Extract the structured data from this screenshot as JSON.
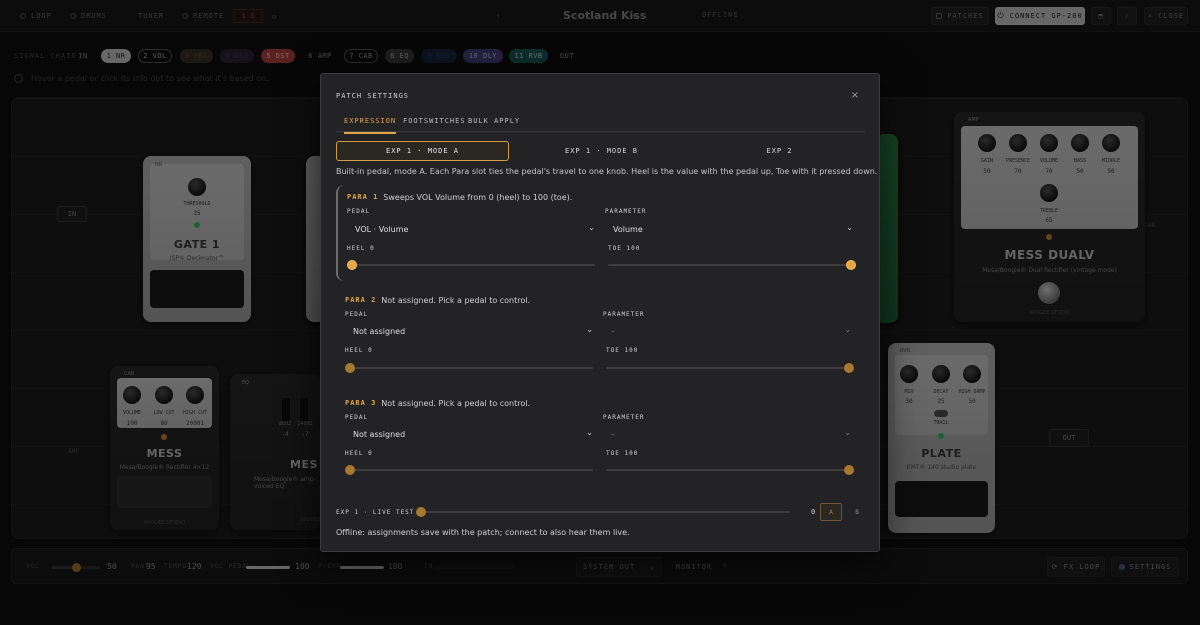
{
  "topbar": {
    "loop": "LOOP",
    "drums": "DRUMS",
    "tuner": "TUNER",
    "remote": "REMOTE",
    "midi": "1 3",
    "patch_title": "Scotland Kiss",
    "status": "OFFLINE",
    "patches": "PATCHES",
    "connect": "CONNECT GP-200",
    "close": "CLOSE"
  },
  "chain": {
    "label": "SIGNAL CHAIN",
    "chips": [
      {
        "label": "IN"
      },
      {
        "label": "1 NR"
      },
      {
        "label": "2 VOL"
      },
      {
        "label": "3 PRE"
      },
      {
        "label": "4 DST"
      },
      {
        "label": "5 DST"
      },
      {
        "label": "6 AMP"
      },
      {
        "label": "7 CAB"
      },
      {
        "label": "8 EQ"
      },
      {
        "label": "9 MOD"
      },
      {
        "label": "10 DLY"
      },
      {
        "label": "11 RVB"
      },
      {
        "label": "OUT"
      }
    ],
    "hint": "Hover a pedal or click its info dot to see what it's based on."
  },
  "board": {
    "in_label": "IN",
    "out_label": "OUT",
    "amp_label": "AMP",
    "cab_label": "CAB",
    "gate": {
      "tag": "NR",
      "slot": "1",
      "knob_label": "THRESHOLD",
      "knob_value": "35",
      "name": "GATE 1",
      "sub": "ISP® Decimator™",
      "brand": "APOGEE STUDIO"
    },
    "cab": {
      "tag": "CAB",
      "slot": "7",
      "knobs": [
        {
          "label": "VOLUME",
          "value": "100"
        },
        {
          "label": "LOW CUT",
          "value": "80"
        },
        {
          "label": "HIGH CUT",
          "value": "20001"
        }
      ],
      "name": "MESS",
      "sub": "Mesa/Boogie® Rectifier 4×12",
      "brand": "APOGEE STUDIO"
    },
    "eq": {
      "tag": "EQ",
      "bands": [
        {
          "label": "80HZ",
          "value": "-4"
        },
        {
          "label": "240HZ",
          "value": "-7"
        }
      ],
      "name": "MES",
      "sub": "Mesa/Boogie® amp-voiced EQ",
      "brand": "APOGEE"
    },
    "amp": {
      "tag": "AMP",
      "knobs": [
        {
          "label": "GAIN",
          "value": "50"
        },
        {
          "label": "PRESENCE",
          "value": "70"
        },
        {
          "label": "VOLUME",
          "value": "70"
        },
        {
          "label": "BASS",
          "value": "50"
        },
        {
          "label": "MIDDLE",
          "value": "50"
        }
      ],
      "treble_label": "TREBLE",
      "treble_value": "65",
      "name": "MESS DUALV",
      "sub": "Mesa/Boogie® Dual Rectifier (vintage mode)",
      "brand": "APOGEE STUDIO"
    },
    "reverb": {
      "tag": "RVB",
      "knobs": [
        {
          "label": "MIX",
          "value": "30"
        },
        {
          "label": "DECAY",
          "value": "25"
        },
        {
          "label": "HIGH DAMP",
          "value": "50"
        }
      ],
      "trail_label": "TRAIL",
      "name": "PLATE",
      "sub": "EMT® 140 studio plate"
    }
  },
  "bottombar": {
    "vol_label": "VOL",
    "vol_value": "50",
    "vol_level": 0.5,
    "pan_label": "PAN",
    "pan_value": "95",
    "tempo_label": "TEMPO",
    "tempo_value": "120",
    "vol_pedal_label": "VOL PEDAL",
    "vol_pedal_value": "100",
    "vol_pedal_level": 1.0,
    "exp_label": "P-EXP",
    "exp_value": "100",
    "exp_level": 1.0,
    "in_label": "IN",
    "output": "SYSTEM OUT",
    "monitor": "MONITOR",
    "fx_loop": "FX LOOP",
    "settings": "SETTINGS"
  },
  "modal": {
    "title": "PATCH SETTINGS",
    "close_glyph": "×",
    "tabs": [
      "EXPRESSION",
      "FOOTSWITCHES",
      "BULK APPLY"
    ],
    "segments": [
      "EXP 1 · MODE A",
      "EXP 1 · MODE B",
      "EXP 2"
    ],
    "description": "Built-in pedal, mode A. Each Para slot ties the pedal's travel to one knob. Heel is the value with the pedal up, Toe with it pressed down.",
    "field_labels": {
      "pedal": "PEDAL",
      "parameter": "PARAMETER",
      "heel": "HEEL",
      "toe": "TOE"
    },
    "paras": [
      {
        "tag": "PARA 1",
        "text": "Sweeps VOL Volume from 0 (heel) to 100 (toe).",
        "pedal": "VOL · Volume",
        "parameter": "Volume",
        "heel": "0",
        "toe": "100",
        "heel_level": 0.0,
        "toe_level": 1.0
      },
      {
        "tag": "PARA 2",
        "text": "Not assigned. Pick a pedal to control.",
        "pedal": "Not assigned",
        "parameter": "–",
        "heel": "0",
        "toe": "100",
        "heel_level": 0.0,
        "toe_level": 1.0
      },
      {
        "tag": "PARA 3",
        "text": "Not assigned. Pick a pedal to control.",
        "pedal": "Not assigned",
        "parameter": "–",
        "heel": "0",
        "toe": "100",
        "heel_level": 0.0,
        "toe_level": 1.0
      }
    ],
    "live_test": {
      "label": "EXP 1 · LIVE TEST",
      "value": "0",
      "level": 0.0,
      "btn_a": "A",
      "btn_b": "B"
    },
    "footer": "Offline: assignments save with the patch; connect to also hear them live."
  },
  "colors": {
    "accent": "#e0a547",
    "modal_bg": "#232325",
    "page_bg": "#0f0f10"
  }
}
